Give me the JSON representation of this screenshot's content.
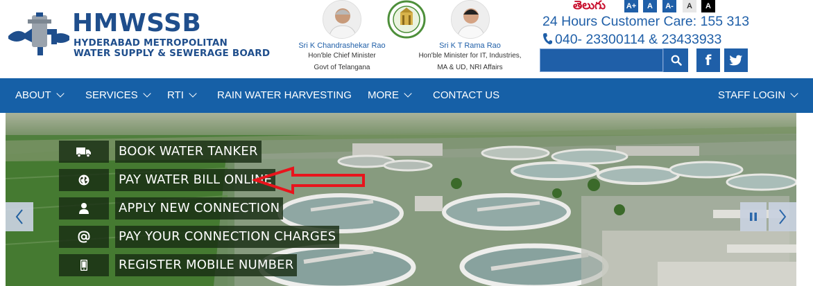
{
  "brand": {
    "name": "HMWSSB",
    "subtitle_line1": "HYDERABAD METROPOLITAN",
    "subtitle_line2": "WATER SUPPLY & SEWERAGE BOARD",
    "color": "#1f4e8c"
  },
  "dignitaries": [
    {
      "name": "Sri K Chandrashekar Rao",
      "role_line1": "Hon'ble Chief Minister",
      "role_line2": "Govt of Telangana"
    },
    {
      "name": "Sri K T Rama Rao",
      "role_line1": "Hon'ble Minister for IT, Industries,",
      "role_line2": "MA & UD, NRI Affairs"
    }
  ],
  "accessibility": {
    "language_link": "తెలుగు",
    "font_increase": "A+",
    "font_normal": "A",
    "font_decrease": "A-",
    "contrast_light": "A",
    "contrast_dark": "A"
  },
  "contact": {
    "customer_care": "24 Hours Customer Care: 155 313",
    "phone": "040- 23300114 & 23433933"
  },
  "search": {
    "placeholder": "",
    "value": "",
    "icon": "search-icon"
  },
  "social": {
    "facebook": "f",
    "twitter": "twitter-icon"
  },
  "nav": {
    "items": [
      {
        "label": "ABOUT",
        "has_dropdown": true
      },
      {
        "label": "SERVICES",
        "has_dropdown": true
      },
      {
        "label": "RTI",
        "has_dropdown": true
      },
      {
        "label": "RAIN WATER HARVESTING",
        "has_dropdown": false
      },
      {
        "label": "MORE",
        "has_dropdown": true
      },
      {
        "label": "CONTACT US",
        "has_dropdown": false
      }
    ],
    "staff_login": {
      "label": "STAFF LOGIN",
      "has_dropdown": true
    }
  },
  "quick_links": [
    {
      "label": "BOOK WATER TANKER",
      "icon": "truck-icon"
    },
    {
      "label": "PAY WATER BILL ONLINE",
      "icon": "globe-icon"
    },
    {
      "label": "APPLY NEW CONNECTION",
      "icon": "user-icon"
    },
    {
      "label": "PAY YOUR CONNECTION CHARGES",
      "icon": "at-sign-icon"
    },
    {
      "label": "REGISTER MOBILE NUMBER",
      "icon": "mobile-icon"
    }
  ],
  "annotation": {
    "type": "red-arrow",
    "points_to": "PAY WATER BILL ONLINE"
  },
  "slider": {
    "prev": "‹",
    "pause": "pause-icon",
    "next": "›"
  },
  "colors": {
    "nav_bg": "#1660a7",
    "link_blue": "#1f5fa8",
    "telugu_red": "#c8102e",
    "annotation_red": "#e8141c"
  }
}
